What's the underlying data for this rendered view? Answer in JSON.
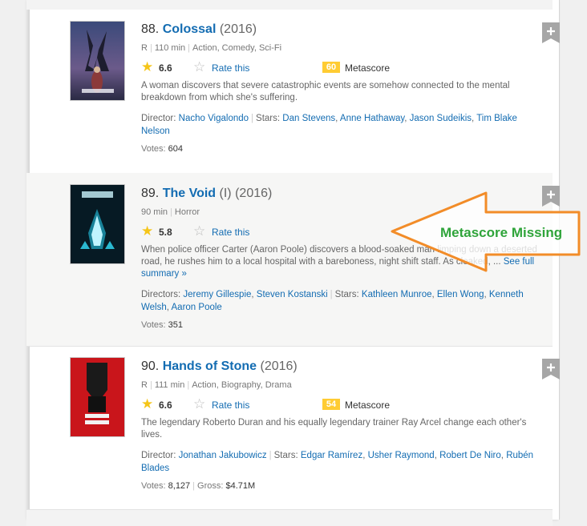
{
  "movies": [
    {
      "index": "88.",
      "title": "Colossal",
      "year": "(2016)",
      "certificate": "R",
      "runtime": "110 min",
      "genres": "Action, Comedy, Sci-Fi",
      "rating": "6.6",
      "rate_label": "Rate this",
      "metascore": "60",
      "metascore_label": "Metascore",
      "description": "A woman discovers that severe catastrophic events are somehow connected to the mental breakdown from which she's suffering.",
      "director_label": "Director:",
      "directors": [
        "Nacho Vigalondo"
      ],
      "stars_label": "Stars:",
      "stars": [
        "Dan Stevens",
        "Anne Hathaway",
        "Jason Sudeikis",
        "Tim Blake Nelson"
      ],
      "votes_label": "Votes:",
      "votes": "604"
    },
    {
      "index": "89.",
      "title": "The Void",
      "title_suffix": "(I)",
      "year": "(2016)",
      "runtime": "90 min",
      "genres": "Horror",
      "rating": "5.8",
      "rate_label": "Rate this",
      "description": "When police officer Carter (Aaron Poole) discovers a blood-soaked man limping down a deserted road, he rushes him to a local hospital with a bareboness, night shift staff. As cloaked, ...",
      "see_full_summary": "See full summary »",
      "director_label": "Directors:",
      "directors": [
        "Jeremy Gillespie",
        "Steven Kostanski"
      ],
      "stars_label": "Stars:",
      "stars": [
        "Kathleen Munroe",
        "Ellen Wong",
        "Kenneth Welsh",
        "Aaron Poole"
      ],
      "votes_label": "Votes:",
      "votes": "351"
    },
    {
      "index": "90.",
      "title": "Hands of Stone",
      "year": "(2016)",
      "certificate": "R",
      "runtime": "111 min",
      "genres": "Action, Biography, Drama",
      "rating": "6.6",
      "rate_label": "Rate this",
      "metascore": "54",
      "metascore_label": "Metascore",
      "description": "The legendary Roberto Duran and his equally legendary trainer Ray Arcel change each other's lives.",
      "director_label": "Director:",
      "directors": [
        "Jonathan Jakubowicz"
      ],
      "stars_label": "Stars:",
      "stars": [
        "Edgar Ramírez",
        "Usher Raymond",
        "Robert De Niro",
        "Rubén Blades"
      ],
      "votes_label": "Votes:",
      "votes": "8,127",
      "gross_label": "Gross:",
      "gross": "$4.71M"
    }
  ],
  "annotation": {
    "text": "Metascore Missing",
    "arrow_color": "#f28c28",
    "text_color": "#2fa43a"
  },
  "colors": {
    "link": "#136cb2",
    "metascore_bg": "#ffcc33",
    "star": "#f5c518"
  },
  "icons": [
    "star-icon",
    "empty-star-icon",
    "watchlist-plus-icon"
  ]
}
